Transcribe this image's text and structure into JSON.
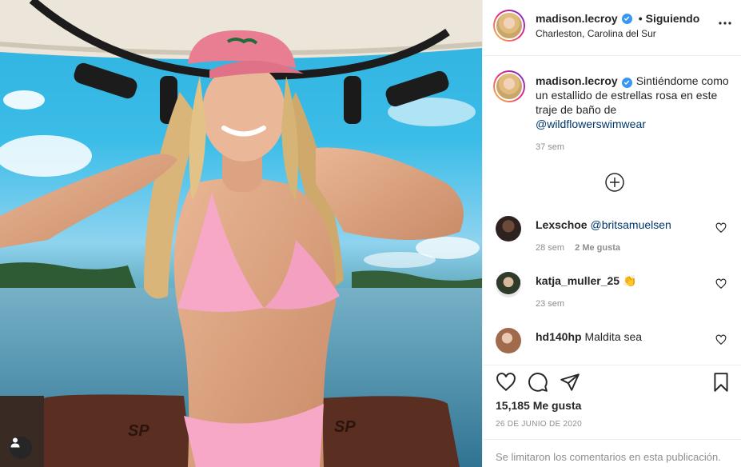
{
  "post": {
    "username": "madison.lecroy",
    "follow_separator": "•",
    "follow_status": "Siguiendo",
    "location": "Charleston, Carolina del Sur",
    "verified": true
  },
  "caption": {
    "username": "madison.lecroy",
    "text": "Sintiéndome como un estallido de estrellas rosa en este traje de baño de",
    "mention": "@wildflowerswimwear",
    "time": "37 sem"
  },
  "comments": [
    {
      "username": "Lexschoe",
      "text": "@britsamuelsen",
      "is_mention": true,
      "time": "28 sem",
      "likes": "2 Me gusta"
    },
    {
      "username": "katja_muller_25",
      "text": "👏",
      "is_mention": false,
      "time": "23 sem",
      "likes": ""
    },
    {
      "username": "hd140hp",
      "text": "Maldita sea",
      "is_mention": false,
      "time": "",
      "likes": ""
    }
  ],
  "engagement": {
    "likes": "15,185 Me gusta",
    "date": "26 DE JUNIO DE 2020",
    "comments_limited": "Se limitaron los comentarios en esta publicación."
  },
  "icons": {
    "more": "more-options-icon",
    "like": "heart-icon",
    "comment": "comment-icon",
    "share": "share-icon",
    "save": "bookmark-icon",
    "load_more": "plus-circle-icon",
    "tag": "user-tag-icon",
    "verified": "verified-badge-icon"
  },
  "colors": {
    "verified": "#3897f0",
    "mention": "#00376b",
    "muted": "#8e8e8e",
    "border": "#efefef"
  }
}
